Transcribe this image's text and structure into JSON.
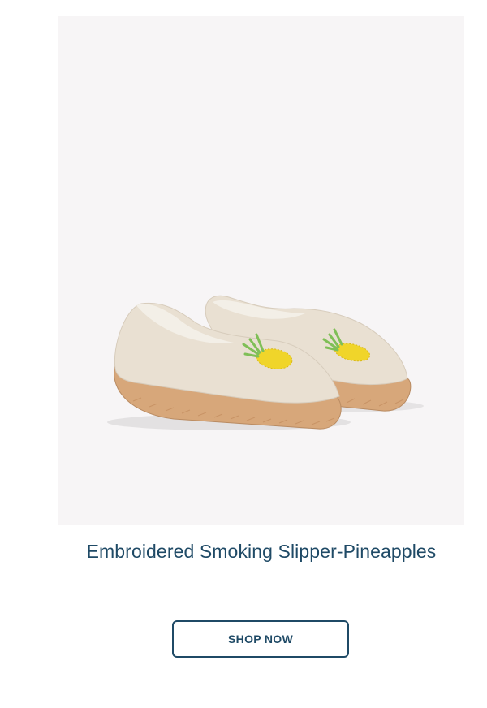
{
  "product": {
    "image_subject": "espadrille-slippers-pineapple",
    "title": "Embroidered Smoking Slipper-Pineapples",
    "cta_label": "SHOP NOW"
  },
  "colors": {
    "image_background": "#f7f5f6",
    "text_primary": "#1f4a66",
    "canvas": "#f1ece4",
    "jute": "#d7a77a",
    "pineapple": "#f0d52a",
    "leaf": "#7fbf57"
  }
}
